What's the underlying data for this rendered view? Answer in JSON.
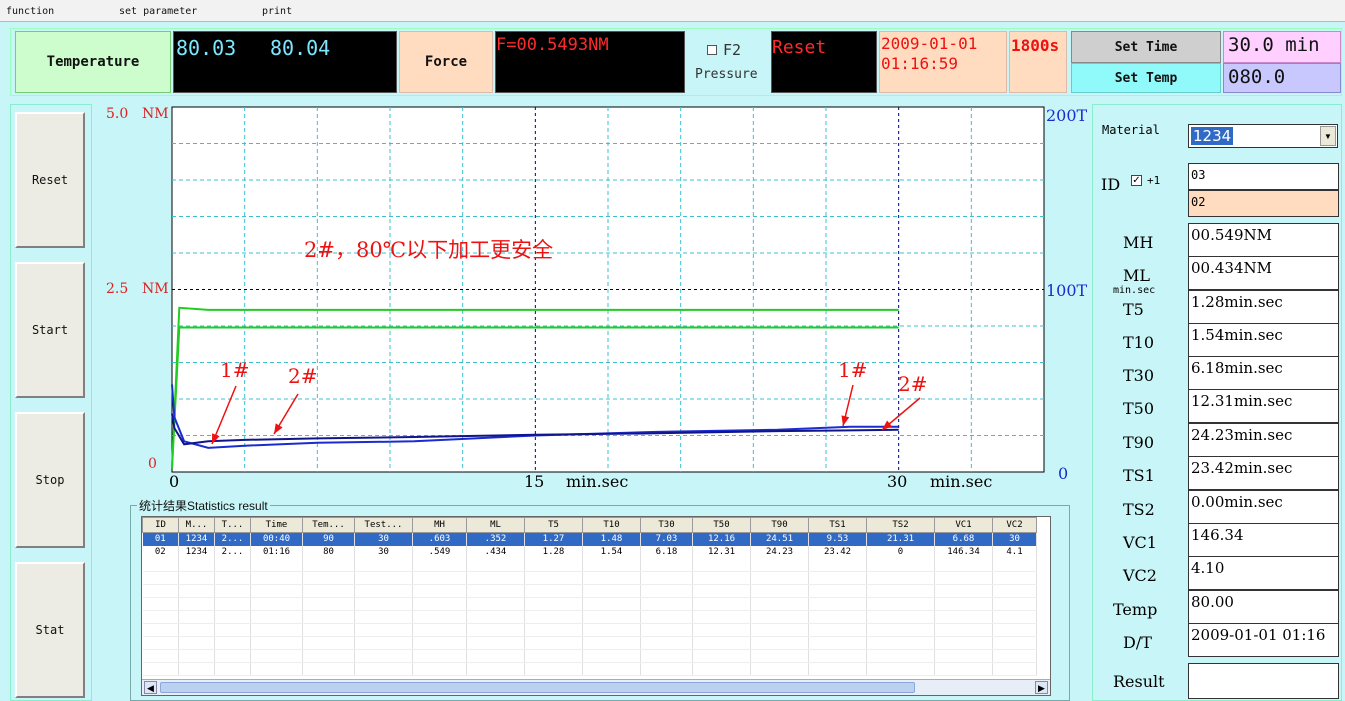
{
  "menu": {
    "function": "function",
    "set_parameter": "set parameter",
    "print": "print"
  },
  "top": {
    "temperature_label": "Temperature",
    "temp_value_1": "80.03",
    "temp_value_2": "80.04",
    "force_label": "Force",
    "force_value": "F=00.5493NM",
    "f2_label": "F2",
    "pressure_label": "Pressure",
    "reset_label": "Reset",
    "date": "2009-01-01",
    "time": "01:16:59",
    "duration": "1800s",
    "set_time_label": "Set Time",
    "set_time_value": "30.0 min",
    "set_temp_label": "Set Temp",
    "set_temp_value": "080.0"
  },
  "left_panel": {
    "reset": "Reset",
    "start": "Start",
    "stop": "Stop",
    "stat": "Stat"
  },
  "chart_data": {
    "type": "line",
    "x_unit": "min.sec",
    "x_ticks": [
      "0",
      "15",
      "30"
    ],
    "x_range": [
      0,
      36
    ],
    "y_left_ticks": [
      "5.0",
      "2.5",
      "0"
    ],
    "y_left_unit": "NM",
    "y_left_range": [
      0,
      5.0
    ],
    "y_right_ticks": [
      "200T",
      "100T",
      "0"
    ],
    "y_right_range": [
      0,
      200
    ],
    "annotation_text": "2#，80℃以下加工更安全",
    "markers": [
      "1#",
      "2#",
      "1#",
      "2#"
    ],
    "series": [
      {
        "color": "#22cc22",
        "x": [
          0,
          0.3,
          1.5,
          30
        ],
        "y": [
          0.05,
          2.25,
          2.22,
          2.22
        ]
      },
      {
        "color": "#22cc22",
        "x": [
          0,
          0.3,
          30
        ],
        "y": [
          0.05,
          1.98,
          1.98
        ]
      },
      {
        "color": "#1a2bd0",
        "x": [
          0,
          0.1,
          0.5,
          1.5,
          3,
          6,
          10,
          15,
          20,
          25,
          28,
          30
        ],
        "y": [
          1.2,
          0.75,
          0.42,
          0.33,
          0.36,
          0.4,
          0.42,
          0.5,
          0.55,
          0.58,
          0.62,
          0.62
        ]
      },
      {
        "color": "#10168a",
        "x": [
          0,
          0.1,
          0.5,
          1.5,
          3,
          6,
          10,
          15,
          20,
          25,
          28,
          30
        ],
        "y": [
          0.8,
          0.6,
          0.38,
          0.42,
          0.44,
          0.46,
          0.48,
          0.51,
          0.53,
          0.56,
          0.57,
          0.58
        ]
      }
    ]
  },
  "stats": {
    "title": "统计结果Statistics result",
    "columns": [
      "ID",
      "M...",
      "T...",
      "Time",
      "Tem...",
      "Test...",
      "MH",
      "ML",
      "T5",
      "T10",
      "T30",
      "T50",
      "T90",
      "TS1",
      "TS2",
      "VC1",
      "VC2"
    ],
    "rows": [
      [
        "01",
        "1234",
        "2...",
        "00:40",
        "90",
        "30",
        ".603",
        ".352",
        "1.27",
        "1.48",
        "7.03",
        "12.16",
        "24.51",
        "9.53",
        "21.31",
        "6.68",
        "30"
      ],
      [
        "02",
        "1234",
        "2...",
        "01:16",
        "80",
        "30",
        ".549",
        ".434",
        "1.28",
        "1.54",
        "6.18",
        "12.31",
        "24.23",
        "23.42",
        "0",
        "146.34",
        "4.1"
      ]
    ]
  },
  "right": {
    "material_label": "Material",
    "material_value": "1234",
    "id_label": "ID",
    "id_plus": "+1",
    "id_value_1": "03",
    "id_value_2": "02",
    "fields": [
      {
        "label": "MH",
        "value": "00.549NM"
      },
      {
        "label": "ML",
        "value": "00.434NM"
      },
      {
        "label": "T5",
        "value": "1.28min.sec"
      },
      {
        "label": "T10",
        "value": "1.54min.sec"
      },
      {
        "label": "T30",
        "value": "6.18min.sec"
      },
      {
        "label": "T50",
        "value": "12.31min.sec"
      },
      {
        "label": "T90",
        "value": "24.23min.sec"
      },
      {
        "label": "TS1",
        "value": "23.42min.sec"
      },
      {
        "label": "TS2",
        "value": "0.00min.sec"
      },
      {
        "label": "VC1",
        "value": "146.34"
      },
      {
        "label": "VC2",
        "value": "4.10"
      },
      {
        "label": "Temp",
        "value": "80.00"
      },
      {
        "label": "D/T",
        "value": "2009-01-01 01:16"
      }
    ],
    "min_sec_note": "min.sec",
    "result_label": "Result",
    "result_value": ""
  }
}
